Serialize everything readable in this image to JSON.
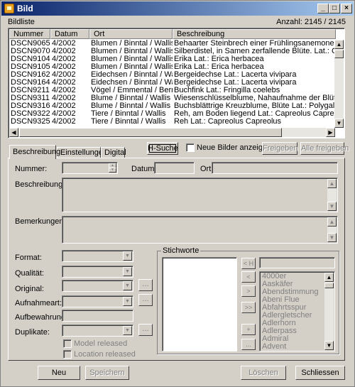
{
  "window": {
    "title": "Bild"
  },
  "header": {
    "list_label": "Bildliste",
    "count": "Anzahl: 2145 / 2145"
  },
  "table": {
    "columns": [
      "Nummer",
      "Datum",
      "Ort",
      "Beschreibung"
    ],
    "rows": [
      [
        "DSCN9065",
        "4/2002",
        "Blumen / Binntal / Wallis",
        "Behaarter Steinbrech einer Frühlingsanemone, Pelzanemone"
      ],
      [
        "DSCN9070",
        "4/2002",
        "Blumen / Binntal / Wallis",
        "Silberdistel, in Samen zerfallende Blüte.  Lat.: Carlina acaulis"
      ],
      [
        "DSCN9104",
        "4/2002",
        "Blumen / Binntal / Wallis",
        "Erika  Lat.: Erica herbacea"
      ],
      [
        "DSCN9105",
        "4/2002",
        "Blumen / Binntal / Wallis",
        "Erika  Lat.: Erica herbacea"
      ],
      [
        "DSCN9162",
        "4/2002",
        "Eidechsen / Binntal / Wallis",
        "Bergeidechse  Lat.: Lacerta vivipara"
      ],
      [
        "DSCN9164",
        "4/2002",
        "Eidechsen / Binntal / Wallis",
        "Bergeidechse  Lat.: Lacerta vivipara"
      ],
      [
        "DSCN9211",
        "4/2002",
        "Vögel / Emmental / Bern",
        "Buchfink  Lat.: Fringilla coelebs"
      ],
      [
        "DSCN9311",
        "4/2002",
        "Blume / Binntal / Wallis",
        "Wiesenschlüsselblume, Nahaufnahme der Blüte  Lat.: Primula"
      ],
      [
        "DSCN9316",
        "4/2002",
        "Blume / Binntal / Wallis",
        "Buchsblättrige Kreuzblume, Blüte  Lat.: Polygala Chamaebuxus"
      ],
      [
        "DSCN9322",
        "4/2002",
        "Tiere / Binntal / Wallis",
        "Reh, am Boden liegend  Lat.: Capreolus  Capreolus"
      ],
      [
        "DSCN9325",
        "4/2002",
        "Tiere / Binntal / Wallis",
        "Reh  Lat.: Capreolus  Capreolus"
      ]
    ]
  },
  "toolbar": {
    "h_suche": "H-Suche",
    "neue_bilder": "Neue Bilder anzeigen",
    "freigeben": "Freigeben",
    "alle_freigeben": "Alle freigeben"
  },
  "tabs": [
    "Beschreibung",
    "Einstellungen",
    "Digital"
  ],
  "form": {
    "nummer": "Nummer:",
    "datum": "Datum:",
    "ort": "Ort:",
    "beschreibung": "Beschreibung:",
    "bemerkungen": "Bemerkungen:",
    "format": "Format:",
    "qualitaet": "Qualität:",
    "original": "Original:",
    "aufnahmeart": "Aufnahmeart:",
    "aufbewahrung": "Aufbewahrung:",
    "duplikate": "Duplikate:",
    "model_released": "Model released",
    "location_released": "Location released",
    "ellipsis": "..."
  },
  "stichworte": {
    "title": "Stichworte",
    "btn_h": "< H",
    "btn_left": "<",
    "btn_right": ">",
    "btn_all": ">>",
    "btn_plus": "+",
    "btn_dots": "...",
    "keywords": [
      "4000er",
      "Aaskäfer",
      "Abendstimmung",
      "Abeni Flue",
      "Abfahrtsspur",
      "Adlergletscher",
      "Adlerhorn",
      "Adlerpass",
      "Admiral",
      "Advent"
    ]
  },
  "bottom": {
    "neu": "Neu",
    "speichern": "Speichern",
    "loeschen": "Löschen",
    "schliessen": "Schliessen"
  }
}
